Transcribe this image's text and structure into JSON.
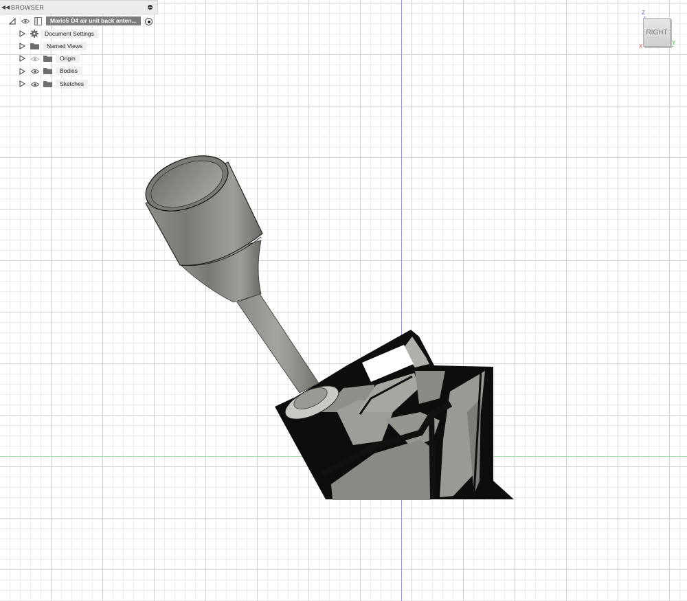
{
  "browser": {
    "title": "BROWSER",
    "root": {
      "label": "Mario5 O4 air unit back anten..."
    },
    "items": [
      {
        "label": "Document Settings",
        "icon": "gear-icon",
        "visible_toggle": false
      },
      {
        "label": "Named Views",
        "icon": "folder-icon",
        "visible_toggle": false
      },
      {
        "label": "Origin",
        "icon": "folder-icon",
        "visible_toggle": true,
        "hidden": true
      },
      {
        "label": "Bodies",
        "icon": "folder-icon",
        "visible_toggle": true,
        "hidden": false
      },
      {
        "label": "Sketches",
        "icon": "folder-icon",
        "visible_toggle": true,
        "hidden": false
      }
    ]
  },
  "viewcube": {
    "face": "RIGHT",
    "axes": {
      "z": "Z",
      "y": "Y",
      "x": "X"
    },
    "colors": {
      "z": "#5b6fd6",
      "y": "#3fb84a",
      "x": "#e04a4a"
    }
  },
  "canvas": {
    "background": "#ffffff",
    "grid_major": "#cfcfcf",
    "grid_minor": "#ebebeb",
    "axis_vertical": "#8a9ad8",
    "axis_horizontal": "#9fe09f",
    "model_color": "#8c8b86"
  }
}
